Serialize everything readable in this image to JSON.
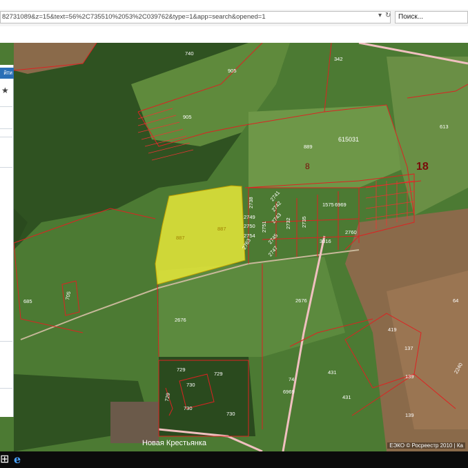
{
  "browser": {
    "url": "82731089&z=15&text=56%2C735510%2053%2C039762&type=1&app=search&opened=1",
    "search_placeholder": "Поиск..."
  },
  "panel": {
    "button_label": "йти",
    "star_icon": "star-icon"
  },
  "map": {
    "place_name": "Новая Крестьянка",
    "copyright": "ЕЭКО © Росреестр 2010 | Ка",
    "quarters": [
      "18",
      "8",
      "615031"
    ],
    "parcels": [
      "740",
      "905",
      "342",
      "905",
      "613",
      "889",
      "1575",
      "6969",
      "2760",
      "3016",
      "2738",
      "2749",
      "2750",
      "2754",
      "2763",
      "2751",
      "2741",
      "2742",
      "2743",
      "2745",
      "2747",
      "2732",
      "2735",
      "887",
      "887",
      "685",
      "705",
      "2676",
      "2676",
      "74",
      "431",
      "6969",
      "431",
      "419",
      "137",
      "139",
      "139",
      "64",
      "2240",
      "729",
      "729",
      "730",
      "730",
      "730",
      "729"
    ]
  },
  "taskbar": {
    "icons": [
      "windows-icon",
      "internet-explorer-icon"
    ]
  }
}
